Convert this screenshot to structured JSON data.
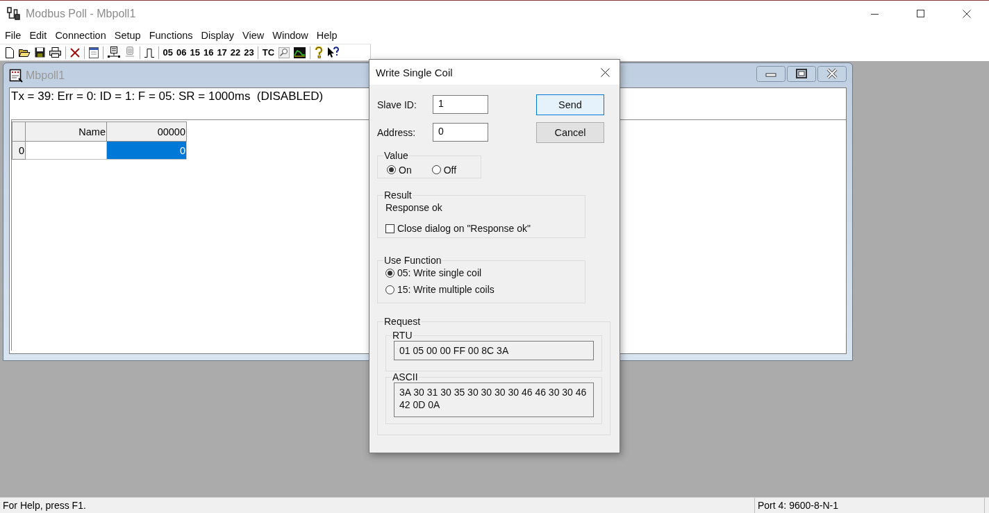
{
  "window": {
    "title": "Modbus Poll - Mbpoll1"
  },
  "menu": [
    "File",
    "Edit",
    "Connection",
    "Setup",
    "Functions",
    "Display",
    "View",
    "Window",
    "Help"
  ],
  "toolbar": {
    "function_buttons": [
      "05",
      "06",
      "15",
      "16",
      "17",
      "22",
      "23"
    ],
    "tc_button": "TC"
  },
  "child_window": {
    "title": "Mbpoll1",
    "status_line": "Tx = 39: Err = 0: ID = 1: F = 05: SR = 1000ms  (DISABLED)",
    "table": {
      "columns": [
        "Name",
        "00000"
      ],
      "rows": [
        {
          "header": "0",
          "value": "0",
          "selected": true
        }
      ]
    }
  },
  "dialog": {
    "title": "Write Single Coil",
    "fields": [
      {
        "label": "Slave ID:",
        "value": "1"
      },
      {
        "label": "Address:",
        "value": "0"
      }
    ],
    "buttons": [
      {
        "label": "Send",
        "kind": "default"
      },
      {
        "label": "Cancel",
        "kind": "normal"
      }
    ],
    "value_group": {
      "title": "Value",
      "options": [
        {
          "label": "On",
          "selected": true
        },
        {
          "label": "Off",
          "selected": false
        }
      ]
    },
    "result_group": {
      "title": "Result",
      "message": "Response ok",
      "close_checkbox": {
        "label": "Close dialog on \"Response ok\"",
        "checked": false
      }
    },
    "function_group": {
      "title": "Use Function",
      "options": [
        {
          "label": "05: Write single coil",
          "selected": true
        },
        {
          "label": "15: Write multiple coils",
          "selected": false
        }
      ]
    },
    "request_group": {
      "title": "Request",
      "rtu": {
        "title": "RTU",
        "value": "01 05 00 00 FF 00 8C 3A"
      },
      "ascii": {
        "title": "ASCII",
        "value": "3A 30 31 30 35 30 30 30 30 46 46 30 30 46 42 0D 0A"
      }
    }
  },
  "status_bar": {
    "help": "For Help, press F1.",
    "port": "Port 4: 9600-8-N-1"
  }
}
